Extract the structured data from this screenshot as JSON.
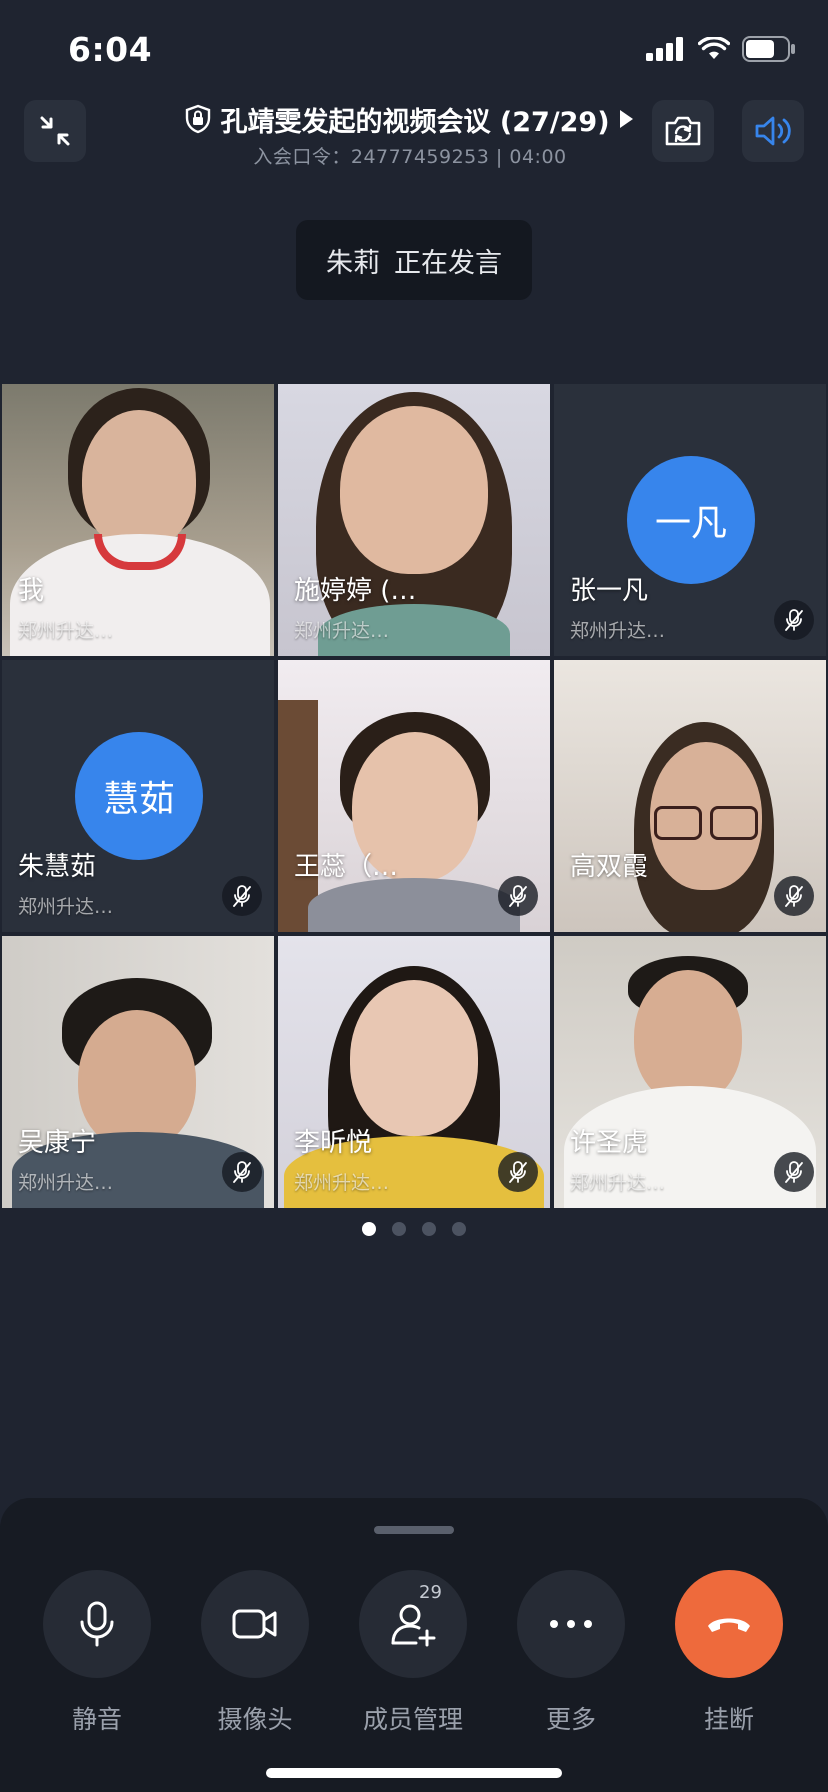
{
  "status_bar": {
    "time": "6:04"
  },
  "header": {
    "title": "孔靖雯发起的视频会议 (27/29)",
    "meeting_code_label": "入会口令：",
    "meeting_code": "24777459253",
    "separator": "|",
    "duration": "04:00"
  },
  "speaking": {
    "name": "朱莉",
    "text": "正在发言"
  },
  "participants": [
    {
      "name": "我",
      "org": "郑州升达…",
      "avatar_text": "",
      "muted": false,
      "video": true
    },
    {
      "name": "施婷婷 (…",
      "org": "郑州升达…",
      "avatar_text": "",
      "muted": false,
      "video": true
    },
    {
      "name": "张一凡",
      "org": "郑州升达…",
      "avatar_text": "一凡",
      "muted": true,
      "video": false
    },
    {
      "name": "朱慧茹",
      "org": "郑州升达…",
      "avatar_text": "慧茹",
      "muted": true,
      "video": false
    },
    {
      "name": "王蕊（…",
      "org": "",
      "avatar_text": "",
      "muted": true,
      "video": true
    },
    {
      "name": "高双霞",
      "org": "",
      "avatar_text": "",
      "muted": true,
      "video": true
    },
    {
      "name": "吴康宁",
      "org": "郑州升达…",
      "avatar_text": "",
      "muted": true,
      "video": true
    },
    {
      "name": "李昕悦",
      "org": "郑州升达…",
      "avatar_text": "",
      "muted": true,
      "video": true
    },
    {
      "name": "许圣虎",
      "org": "郑州升达…",
      "avatar_text": "",
      "muted": true,
      "video": true
    }
  ],
  "pagination": {
    "pages": 4,
    "current": 1
  },
  "controls": {
    "mute_label": "静音",
    "camera_label": "摄像头",
    "members_label": "成员管理",
    "members_count": "29",
    "more_label": "更多",
    "hangup_label": "挂断"
  },
  "colors": {
    "background": "#1f2430",
    "accent_blue": "#3785ec",
    "hangup_orange": "#ee6a3c"
  }
}
